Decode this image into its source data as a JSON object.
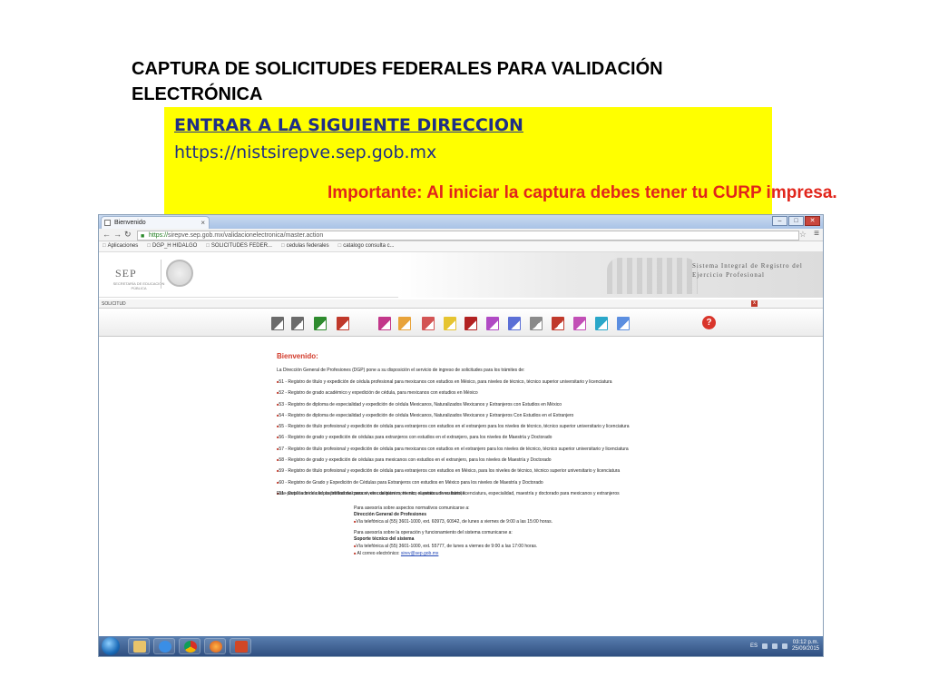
{
  "slide": {
    "title": "CAPTURA DE SOLICITUDES FEDERALES PARA VALIDACIÓN ELECTRÓNICA",
    "direccion_label": "ENTRAR A LA SIGUIENTE DIRECCION",
    "direccion_url": "https://nistsirepve.sep.gob.mx",
    "importante": "Importante: Al iniciar la captura debes tener tu CURP impresa."
  },
  "browser": {
    "tab_title": "Bienvenido",
    "tab_close": "×",
    "window_buttons": [
      "–",
      "□",
      "✕"
    ],
    "url_https": "https://",
    "url_rest": "sirepve.sep.gob.mx/validacionelectronica/master.action",
    "bookmarks": [
      "Aplicaciones",
      "DGP_H HIDALGO",
      "SOLICITUDES FEDER...",
      "cedulas federales",
      "catalogo consulta c..."
    ],
    "header": {
      "sep_logo": "SEP",
      "sep_sub": "SECRETARÍA DE EDUCACIÓN PÚBLICA",
      "system_title": "Sistema Integral de Registro del Ejercicio Profesional"
    },
    "solicitud_label": "SOLICITUD",
    "help_icon": "?",
    "close_icon": "x",
    "colors": {
      "toolbar_icons": [
        "#6b6b6b",
        "#6b6b6b",
        "#2e8b2e",
        "#c0392b",
        "#c2378a",
        "#e8a33a",
        "#d35454",
        "#e6c430",
        "#b22222",
        "#b04ac4",
        "#5b6fd6",
        "#8a8a8a",
        "#c0392b",
        "#c24fb6",
        "#2aa7c9",
        "#5b8ee0"
      ]
    },
    "content": {
      "greeting": "Bienvenido:",
      "intro": "La Dirección General de Profesiones (DGP) pone a su disposición el servicio de ingreso de solicitudes para los trámites de:",
      "programs": [
        "51 - Registro de título y expedición de cédula profesional para mexicanos con estudios en México, para niveles de técnico, técnico superior universitario y licenciatura",
        "52 - Registro de grado académico y expedición de cédula, para mexicanos con estudios en México",
        "53 - Registro de diploma de especialidad y expedición de cédula Mexicanos, Naturalizados Mexicanos y Extranjeros con Estudios en México",
        "54 - Registro de diploma de especialidad y expedición de cédula Mexicanos, Naturalizados Mexicanos y Extranjeros Con Estudios en el Extranjero",
        "55 - Registro de título profesional y expedición de cédula para extranjeros con estudios en el extranjero para los niveles de técnico, técnico superior universitario y licenciatura",
        "56 - Registro de grado y expedición de cédulas para extranjeros con estudios en el extranjero, para los niveles de Maestría y Doctorado",
        "57 - Registro de título profesional y expedición de cédula para mexicanos con estudios en el extranjero para los niveles de técnico, técnico superior universitario y licenciatura",
        "58 - Registro de grado y expedición de cédulas para mexicanos con estudios en el extranjero, para los niveles de Maestría y Doctorado",
        "59 - Registro de título profesional y expedición de cédula para extranjeros con estudios en México, para los niveles de técnico, técnico superior universitario y licenciatura",
        "60 - Registro de Grado y Expedición de Cédulas para Extranjeros con estudios en México para los niveles de Maestría y Doctorado",
        "61 - Duplicado de cédula profesional para niveles de técnico, técnico superior universitario, licenciatura, especialidad, maestría y doctorado para mexicanos y extranjeros"
      ],
      "portal_note": "Este portal le brinda la posibilidad de conocer, en cualquier momento, el estatus de su trámite.",
      "asesoria_normativa": "Para asesoría sobre aspectos normativos comunicarse a:",
      "dgp_name": "Dirección General de Profesiones",
      "dgp_phone": "Vía telefónica al (55) 3601-1000, ext. 60973, 60942, de lunes a viernes de 9:00 a las 15:00 horas.",
      "asesoria_operacion": "Para asesoría sobre la operación y funcionamiento del sistema comunicarse a:",
      "soporte_name": "Soporte técnico del sistema",
      "soporte_phone": "Vía telefónica al (55) 3601-1000, ext. 55777, de lunes a viernes de 9:00 a las 17:00 horas.",
      "soporte_email_label": "Al correo electrónico:",
      "soporte_email": "sirev@sep.gob.mx"
    },
    "taskbar": {
      "language": "ES",
      "time": "03:12 p.m.",
      "date": "25/09/2015"
    }
  }
}
